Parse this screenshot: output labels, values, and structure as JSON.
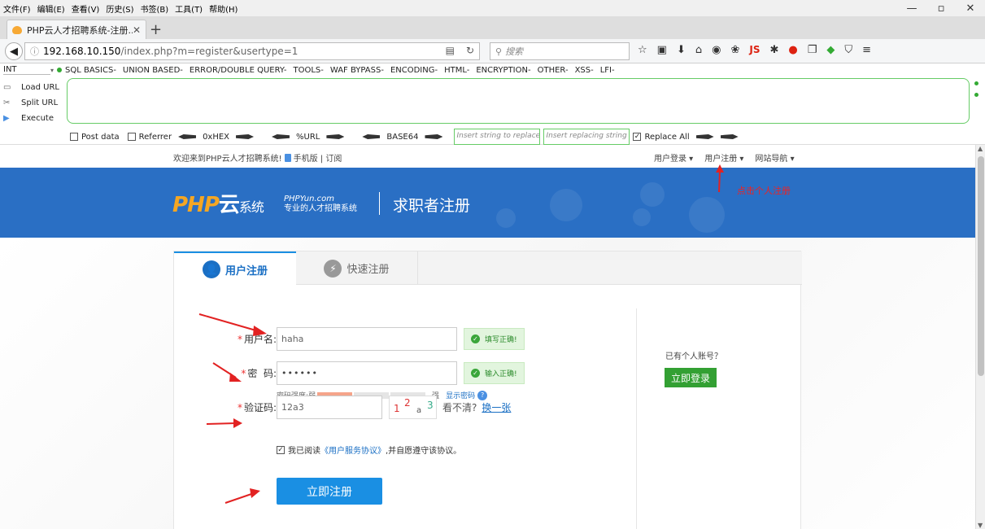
{
  "menu": [
    "文件(F)",
    "编辑(E)",
    "查看(V)",
    "历史(S)",
    "书签(B)",
    "工具(T)",
    "帮助(H)"
  ],
  "window": {
    "min": "—",
    "restore": "▫",
    "close": "✕"
  },
  "tab": {
    "title": "PHP云人才招聘系统-注册...",
    "close": "✕",
    "new": "+"
  },
  "url": {
    "host": "192.168.10.150",
    "path": "/index.php?m=register&usertype=1"
  },
  "search": {
    "placeholder": "搜索"
  },
  "hackbar": {
    "select": "INT",
    "menu": [
      "SQL BASICS-",
      "UNION BASED-",
      "ERROR/DOUBLE QUERY-",
      "TOOLS-",
      "WAF BYPASS-",
      "ENCODING-",
      "HTML-",
      "ENCRYPTION-",
      "OTHER-",
      "XSS-",
      "LFI-"
    ],
    "load": "Load URL",
    "split": "Split URL",
    "execute": "Execute",
    "post": "Post data",
    "referrer": "Referrer",
    "hex": "0xHEX",
    "urlenc": "%URL",
    "b64": "BASE64",
    "insert": "Insert string to replace",
    "replacing": "Insert replacing string",
    "replace_all": "Replace All"
  },
  "site": {
    "welcome": "欢迎来到PHP云人才招聘系统!",
    "mobile": "手机版 | 订阅",
    "links": [
      "用户登录 ▾",
      "用户注册 ▾",
      "网站导航 ▾"
    ],
    "logo_php": "PHP",
    "logo_yun": "云",
    "logo_sys": "系统",
    "slogan_en": "PHPYun.com",
    "slogan_cn": "专业的人才招聘系统",
    "page_title": "求职者注册",
    "annotation": "点击个人注册"
  },
  "form": {
    "tab_user": "用户注册",
    "tab_quick": "快速注册",
    "username_label": "用户名:",
    "username_value": "haha",
    "username_ok": "填写正确!",
    "password_label": "密  码:",
    "password_value": "••••••",
    "password_ok": "输入正确!",
    "strength_label": "密码强度:弱",
    "strength_strong": "强",
    "show_pwd": "显示密码",
    "captcha_label": "验证码:",
    "captcha_value": "12a3",
    "captcha_img": [
      "1",
      "2",
      "a",
      "3"
    ],
    "cant_see": "看不清?",
    "change": "换一张",
    "agree_pre": "我已阅读",
    "agree_link": "《用户服务协议》",
    "agree_post": ",并自愿遵守该协议。",
    "submit": "立即注册",
    "have_account": "已有个人账号？",
    "login_now": "立即登录"
  },
  "colors": {
    "brand": "#2a6fc4",
    "accent": "#1a8fe3",
    "ok": "#3aa63a",
    "annot": "#e22222"
  }
}
